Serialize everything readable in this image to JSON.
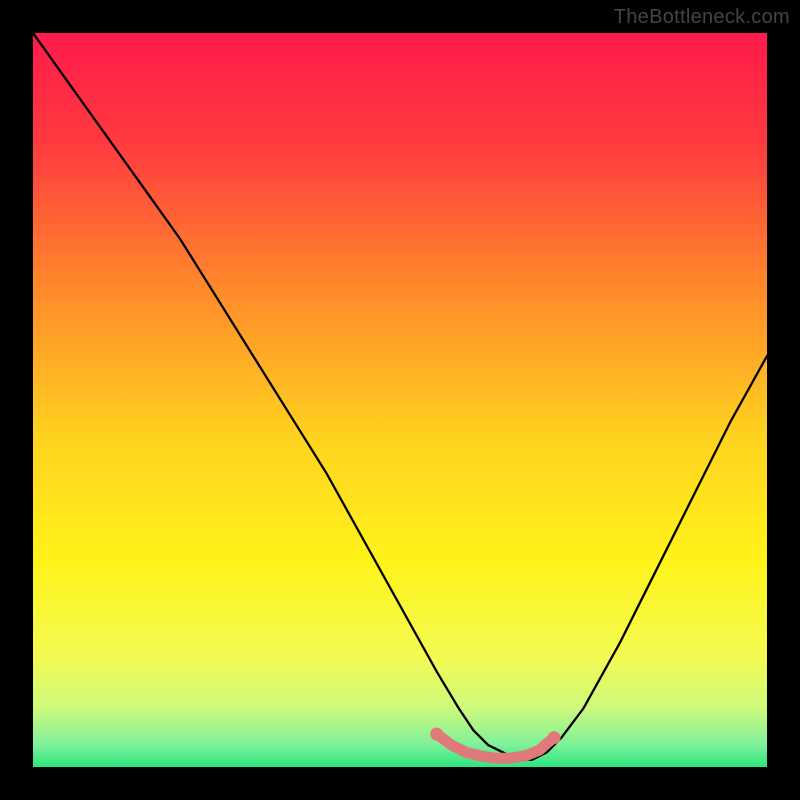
{
  "watermark": "TheBottleneck.com",
  "chart_data": {
    "type": "line",
    "title": "",
    "xlabel": "",
    "ylabel": "",
    "xlim": [
      0,
      100
    ],
    "ylim": [
      0,
      100
    ],
    "background_gradient_stops": [
      {
        "pos": 0,
        "color": "#ff1a4b"
      },
      {
        "pos": 15,
        "color": "#ff3a3f"
      },
      {
        "pos": 35,
        "color": "#ff8a2b"
      },
      {
        "pos": 55,
        "color": "#ffd21f"
      },
      {
        "pos": 72,
        "color": "#fff31a"
      },
      {
        "pos": 85,
        "color": "#f3fb52"
      },
      {
        "pos": 92,
        "color": "#cdf97d"
      },
      {
        "pos": 97,
        "color": "#7ef19a"
      },
      {
        "pos": 100,
        "color": "#2de57f"
      }
    ],
    "series": [
      {
        "name": "bottleneck-curve",
        "color": "#000000",
        "x": [
          0,
          5,
          10,
          15,
          20,
          25,
          30,
          35,
          40,
          45,
          50,
          55,
          58,
          60,
          62,
          64,
          66,
          68,
          70,
          72,
          75,
          80,
          85,
          90,
          95,
          100
        ],
        "y": [
          100,
          93,
          86,
          79,
          72,
          64,
          56,
          48,
          40,
          31,
          22,
          13,
          8,
          5,
          3,
          2,
          1,
          1,
          2,
          4,
          8,
          17,
          27,
          37,
          47,
          56
        ]
      }
    ],
    "highlight": {
      "name": "optimal-range",
      "color": "#e07a7a",
      "points_x": [
        55,
        57,
        59,
        61,
        63,
        65,
        67,
        69,
        70,
        71
      ],
      "points_y": [
        4.5,
        3.0,
        2.0,
        1.5,
        1.2,
        1.2,
        1.5,
        2.3,
        3.2,
        4.0
      ]
    }
  }
}
